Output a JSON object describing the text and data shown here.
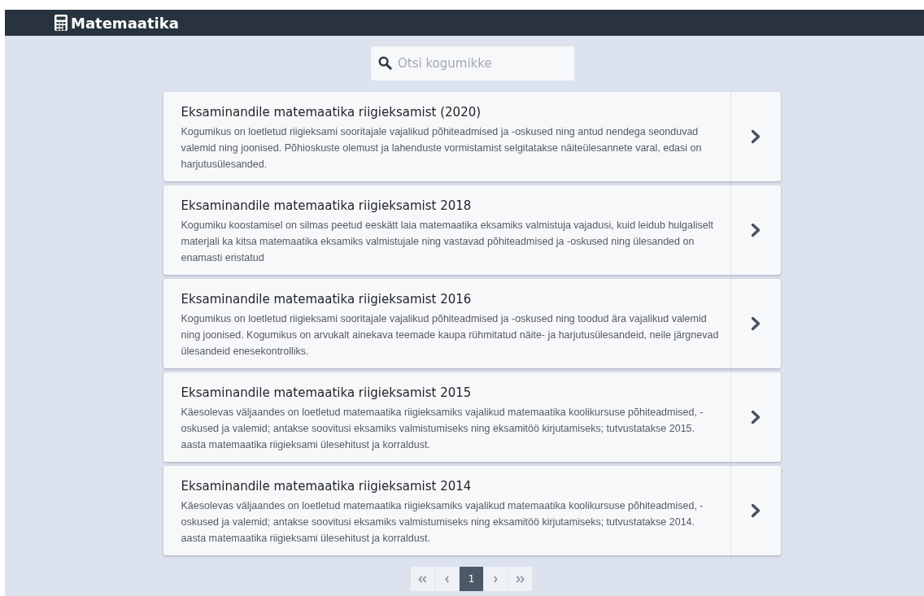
{
  "header": {
    "title": "Matemaatika"
  },
  "search": {
    "placeholder": "Otsi kogumikke"
  },
  "collections": [
    {
      "title": "Eksaminandile matemaatika riigieksamist (2020)",
      "description": "Kogumikus on loetletud riigieksami sooritajale vajalikud põhiteadmised ja -oskused ning antud nendega seonduvad valemid ning joonised. Põhioskuste olemust ja lahenduste vormistamist selgitatakse näiteülesannete varal, edasi on harjutusülesanded."
    },
    {
      "title": "Eksaminandile matemaatika riigieksamist 2018",
      "description": "Kogumiku koostamisel on silmas peetud eeskätt laia matemaatika eksamiks valmistuja vajadusi, kuid leidub hulgaliselt materjali ka kitsa matemaatika eksamiks valmistujale ning vastavad põhiteadmised ja -oskused ning ülesanded on enamasti eristatud"
    },
    {
      "title": "Eksaminandile matemaatika riigieksamist 2016",
      "description": "Kogumikus on loetletud riigieksami sooritajale vajalikud põhiteadmised ja -oskused ning toodud ära vajalikud valemid ning joonised. Kogumikus on arvukalt ainekava teemade kaupa rühmitatud näite- ja harjutusülesandeid, neile järgnevad ülesandeid enesekontrolliks."
    },
    {
      "title": "Eksaminandile matemaatika riigieksamist 2015",
      "description": "Käesolevas väljaandes on loetletud matemaatika riigieksamiks vajalikud matemaatika koolikursuse põhiteadmised, -oskused ja valemid; antakse soovitusi eksamiks valmistumiseks ning eksamitöö kirjutamiseks; tutvustatakse 2015. aasta matemaatika riigieksami ülesehitust ja korraldust."
    },
    {
      "title": "Eksaminandile matemaatika riigieksamist 2014",
      "description": "Käesolevas väljaandes on loetletud matemaatika riigieksamiks vajalikud matemaatika koolikursuse põhiteadmised, -oskused ja valemid; antakse soovitusi eksamiks valmistumiseks ning eksamitöö kirjutamiseks; tutvustatakse 2014. aasta matemaatika riigieksami ülesehitust ja korraldust."
    }
  ],
  "pagination": [
    {
      "kind": "first",
      "selected": false
    },
    {
      "kind": "prev",
      "selected": false
    },
    {
      "kind": "page",
      "label": "1",
      "selected": true
    },
    {
      "kind": "next",
      "selected": false
    },
    {
      "kind": "last",
      "selected": false
    }
  ]
}
